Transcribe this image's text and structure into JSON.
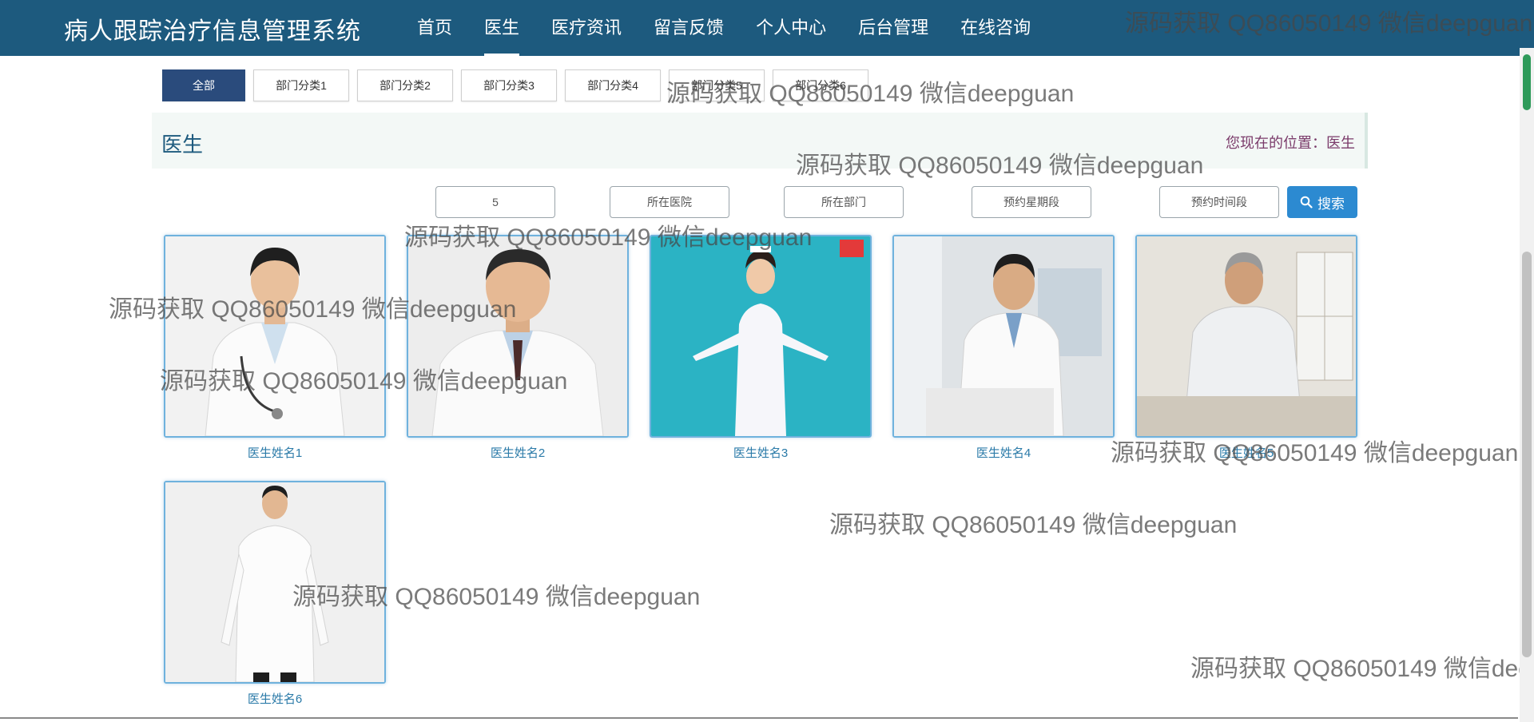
{
  "app": {
    "brand": "病人跟踪治疗信息管理系统"
  },
  "nav": {
    "items": [
      {
        "label": "首页"
      },
      {
        "label": "医生",
        "active": true
      },
      {
        "label": "医疗资讯"
      },
      {
        "label": "留言反馈"
      },
      {
        "label": "个人中心"
      },
      {
        "label": "后台管理"
      },
      {
        "label": "在线咨询"
      }
    ]
  },
  "categories": {
    "items": [
      "全部",
      "部门分类1",
      "部门分类2",
      "部门分类3",
      "部门分类4",
      "部门分类5",
      "部门分类6"
    ],
    "active_index": 0
  },
  "section": {
    "title": "医生",
    "breadcrumb": "您现在的位置：医生"
  },
  "search": {
    "field_1_value": "5",
    "hospital_placeholder": "所在医院",
    "department_placeholder": "所在部门",
    "weekday_placeholder": "预约星期段",
    "timeslot_placeholder": "预约时间段",
    "button_label": "搜索"
  },
  "doctors": [
    {
      "name": "医生姓名1"
    },
    {
      "name": "医生姓名2"
    },
    {
      "name": "医生姓名3"
    },
    {
      "name": "医生姓名4"
    },
    {
      "name": "医生姓名5"
    },
    {
      "name": "医生姓名6"
    }
  ],
  "watermark_text": "源码获取 QQ86050149 微信deepguan",
  "colors": {
    "nav_bg": "#1d5a7e",
    "accent": "#2c8ad1",
    "active_category": "#2a4b7c",
    "doctor_name": "#2a7aa8"
  }
}
